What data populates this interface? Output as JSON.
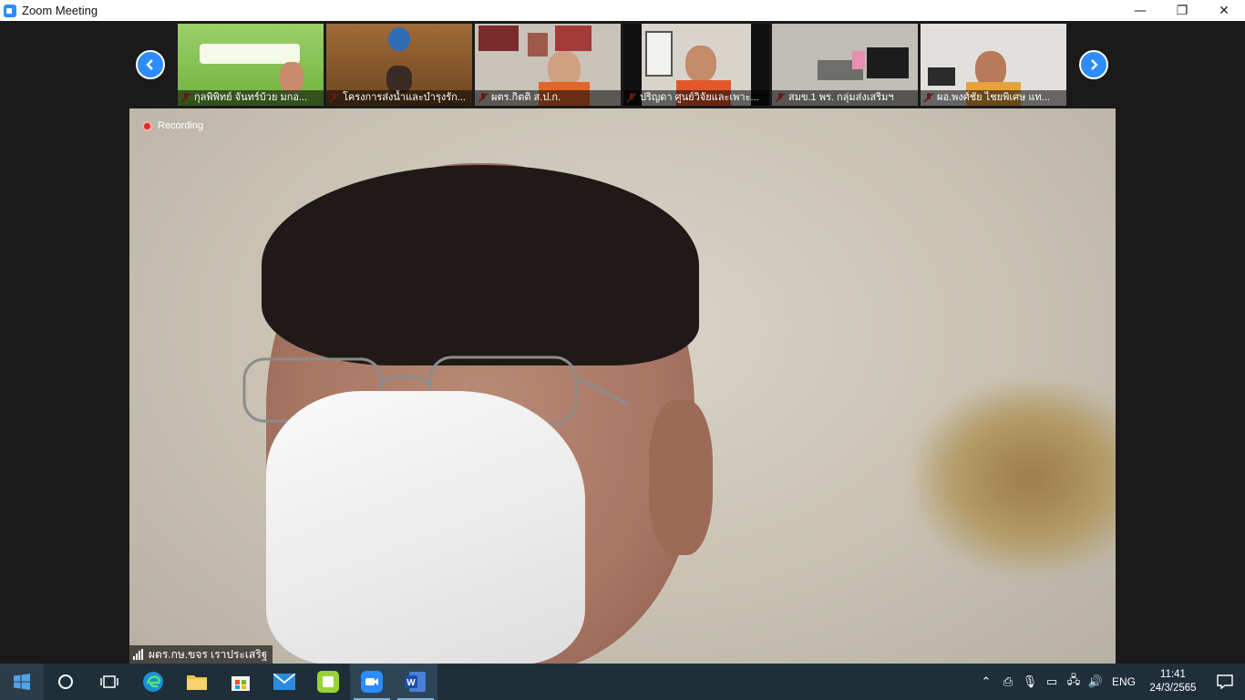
{
  "window": {
    "title": "Zoom Meeting",
    "controls": [
      "—",
      "❐",
      "✕"
    ]
  },
  "gallery": {
    "prev_icon": "chevron-left-icon",
    "next_icon": "chevron-right-icon",
    "participants": [
      {
        "name": "กุลพิพิทย์ จันทร์บ้วย มกอ...",
        "muted": true,
        "bg": "#7ac04a"
      },
      {
        "name": "โครงการส่งน้ำและบำรุงรัก...",
        "muted": true,
        "bg": "#8a5a2a"
      },
      {
        "name": "ผตร.กิตติ ส.ป.ก.",
        "muted": true,
        "bg": "#c9c2b8"
      },
      {
        "name": "ปริญดา ศูนย์วิจัยและเพาะ...",
        "muted": true,
        "bg": "#d8d4cc"
      },
      {
        "name": "สมข.1 พร. กลุ่มส่งเสริมฯ",
        "muted": true,
        "bg": "#bfbdb6"
      },
      {
        "name": "ผอ.พงศ์ชัย ไชยพิเศษ แท...",
        "muted": true,
        "bg": "#e2e0dc"
      }
    ]
  },
  "main": {
    "recording_label": "Recording",
    "speaker_name": "ผตร.กษ.ขจร เราประเสริฐ"
  },
  "taskbar": {
    "apps": [
      "windows-start-icon",
      "search-circle-icon",
      "task-view-icon",
      "edge-icon",
      "file-explorer-icon",
      "store-icon",
      "mail-icon",
      "line-icon",
      "zoom-icon",
      "word-icon"
    ],
    "language": "ENG",
    "time": "11:41",
    "date": "24/3/2565"
  }
}
